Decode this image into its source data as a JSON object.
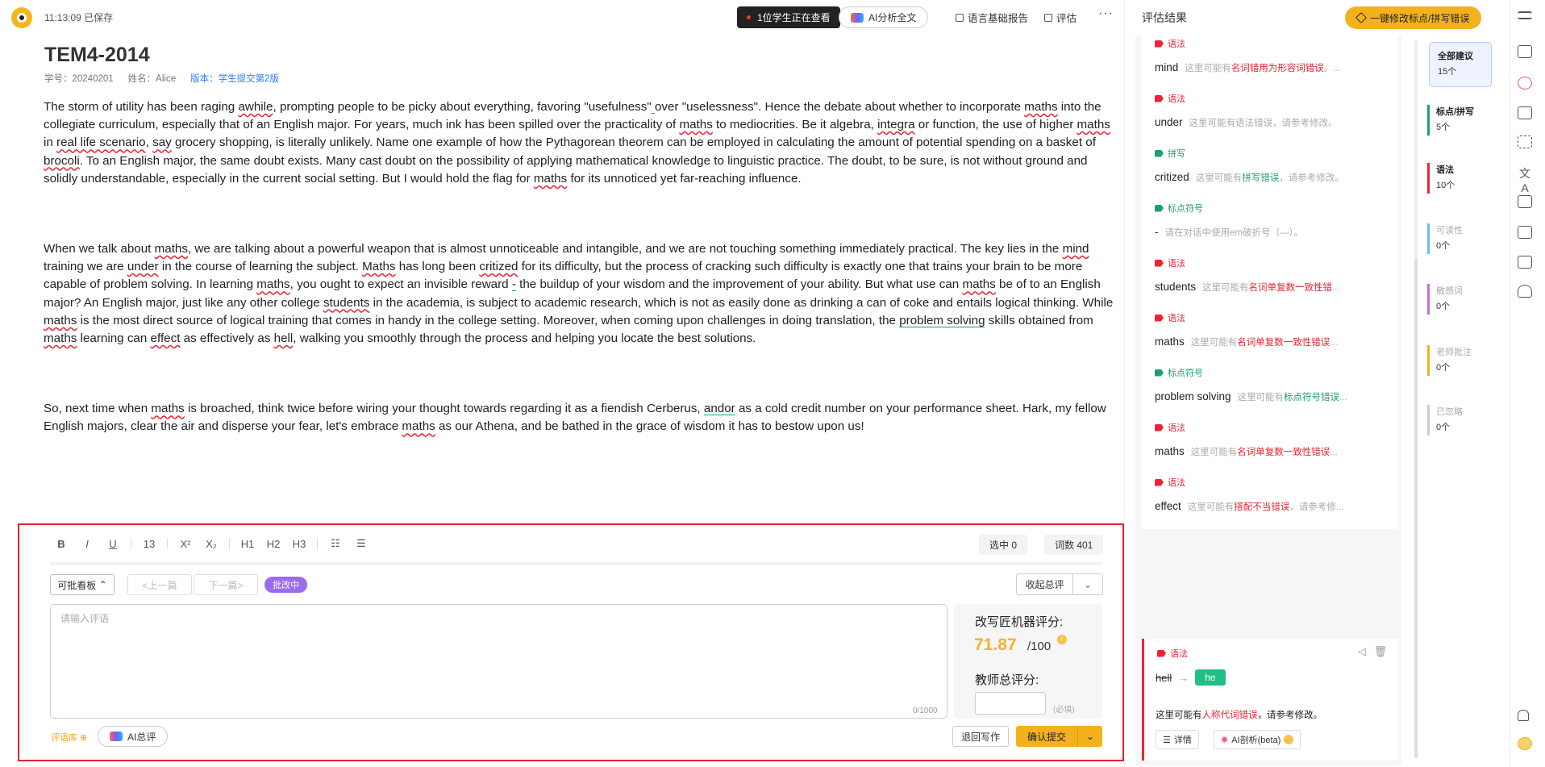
{
  "topbar": {
    "save_time": "11:13:09 已保存",
    "viewers": "1位学生正在查看",
    "ai_analyze": "AI分析全文",
    "lang_report": "语言基础报告",
    "evaluate": "评估",
    "more": "···"
  },
  "doc": {
    "title": "TEM4-2014",
    "student_id": "学号：20240201",
    "name": "姓名：Alice",
    "version": "版本：学生提交第2版",
    "p1": [
      {
        "t": "The storm of utility has been raging "
      },
      {
        "t": "awhile",
        "c": "e-red"
      },
      {
        "t": ", prompting people to be picky about everything, favoring \"usefulness\""
      },
      {
        "t": " ",
        "c": "e-grn"
      },
      {
        "t": "over \"uselessness\". Hence the debate about whether to incorporate "
      },
      {
        "t": "maths",
        "c": "e-red"
      },
      {
        "t": " into the collegiate curriculum, especially that of an English major. For years, much ink has been spilled over the practicality of "
      },
      {
        "t": "maths",
        "c": "e-red"
      },
      {
        "t": " to mediocrities. Be it algebra, "
      },
      {
        "t": "integra",
        "c": "e-red"
      },
      {
        "t": " or function, the use of higher "
      },
      {
        "t": "maths",
        "c": "e-red"
      },
      {
        "t": " in "
      },
      {
        "t": "real life scenario",
        "c": "e-red"
      },
      {
        "t": ", "
      },
      {
        "t": "say",
        "c": "e-red"
      },
      {
        "t": " grocery shopping, is literally unlikely. Name one example of how the Pythagorean theorem can be employed in calculating the amount of potential spending on a basket of "
      },
      {
        "t": "brocoli",
        "c": "e-red"
      },
      {
        "t": ". To an English major, the same doubt exists. Many cast doubt on the possibility of applying mathematical knowledge to linguistic practice. The doubt, to be sure, is not without ground and solidly understandable, especially in the current social setting. But I would hold the flag for "
      },
      {
        "t": "maths",
        "c": "e-red"
      },
      {
        "t": " for its unnoticed yet far-reaching influence."
      }
    ],
    "p2": [
      {
        "t": "When we talk about "
      },
      {
        "t": "maths",
        "c": "e-red"
      },
      {
        "t": ", we are talking about a powerful weapon that is almost unnoticeable and intangible, and we are not touching something immediately practical. The key lies in the "
      },
      {
        "t": "mind",
        "c": "e-red"
      },
      {
        "t": " training we are "
      },
      {
        "t": "under",
        "c": "e-red"
      },
      {
        "t": " in the course of learning the subject. "
      },
      {
        "t": "Maths",
        "c": "e-red"
      },
      {
        "t": " has long been "
      },
      {
        "t": "critized",
        "c": "e-red"
      },
      {
        "t": " for its difficulty, but the process of cracking such difficulty is exactly one that trains your brain to be more capable of problem solving. In learning "
      },
      {
        "t": "maths",
        "c": "e-red"
      },
      {
        "t": ", you ought to expect an invisible reward "
      },
      {
        "t": "-",
        "c": "e-grn"
      },
      {
        "t": " the buildup of your wisdom and the improvement of your ability. But what use can "
      },
      {
        "t": "maths",
        "c": "e-red"
      },
      {
        "t": " be of to an English major? An English major, just like any other college "
      },
      {
        "t": "students",
        "c": "e-red"
      },
      {
        "t": " in the academia, is subject to academic research, which is not as easily done as drinking a can of coke and entails logical thinking. While "
      },
      {
        "t": "maths",
        "c": "e-red"
      },
      {
        "t": " is the most direct source of logical training that comes in handy in the college setting. Moreover, when coming upon challenges in doing translation, the "
      },
      {
        "t": "problem solving",
        "c": "e-grn"
      },
      {
        "t": " skills obtained from "
      },
      {
        "t": "maths",
        "c": "e-red"
      },
      {
        "t": " learning can "
      },
      {
        "t": "effect",
        "c": "e-red"
      },
      {
        "t": " as effectively as "
      },
      {
        "t": "hell",
        "c": "e-red"
      },
      {
        "t": ", walking you smoothly through the process and helping you locate the best solutions."
      }
    ],
    "p3": [
      {
        "t": "So, next time when "
      },
      {
        "t": "maths",
        "c": "e-red"
      },
      {
        "t": " is broached, think twice before wiring your thought towards regarding it as a fiendish Cerberus, "
      },
      {
        "t": "andor",
        "c": "e-grn"
      },
      {
        "t": " as a cold credit number on your performance sheet. Hark, my fellow English majors, clear the air and disperse your fear, let's embrace "
      },
      {
        "t": "maths",
        "c": "e-red"
      },
      {
        "t": " as our Athena, and be bathed in the grace of wisdom it has to bestow upon us!"
      }
    ]
  },
  "editor": {
    "toolbar": [
      "B",
      "I",
      "U",
      "13",
      "X²",
      "X₂",
      "H1",
      "H2",
      "H3"
    ],
    "selected": "选中 0",
    "wordcount": "词数 401",
    "board": "可批看板",
    "prev": "<上一篇",
    "next": "下一篇>",
    "status": "批改中",
    "fold": "收起总评",
    "comment_placeholder": "请输入评语",
    "comment_count": "0/1000",
    "machine_label": "改写匠机器评分:",
    "machine_score": "71.87",
    "machine_max": "/100",
    "teacher_label": "教师总评分:",
    "required": "(必填)",
    "library": "评语库",
    "ai_summary": "AI总评",
    "back": "退回写作",
    "submit": "确认提交"
  },
  "right": {
    "title": "评估结果",
    "fix_all": "一键修改标点/拼写错误",
    "cards": [
      {
        "tag": "语法",
        "color": "#e23",
        "word": "mind",
        "pre": "这里可能有",
        "err": "名词错用为形容词错误",
        "post": "。..."
      },
      {
        "tag": "语法",
        "color": "#e23",
        "word": "under",
        "pre": "这里可能有语法错误，请参考修改。",
        "err": "",
        "post": ""
      },
      {
        "tag": "拼写",
        "color": "#1aa06d",
        "word": "critized",
        "pre": "这里可能有",
        "err": "拼写错误",
        "post": "，请参考修改。",
        "g": true
      },
      {
        "tag": "标点符号",
        "color": "#1aa06d",
        "word": "-",
        "pre": "请在对话中使用em破折号（—）。",
        "err": "",
        "post": ""
      },
      {
        "tag": "语法",
        "color": "#e23",
        "word": "students",
        "pre": "这里可能有",
        "err": "名词单复数一致性错",
        "post": "..."
      },
      {
        "tag": "语法",
        "color": "#e23",
        "word": "maths",
        "pre": "这里可能有",
        "err": "名词单复数一致性错误",
        "post": "..."
      },
      {
        "tag": "标点符号",
        "color": "#1aa06d",
        "word": "problem solving",
        "pre": "这里可能有",
        "err": "标点符号错误",
        "post": "...",
        "g": true
      },
      {
        "tag": "语法",
        "color": "#e23",
        "word": "maths",
        "pre": "这里可能有",
        "err": "名词单复数一致性错误",
        "post": "..."
      },
      {
        "tag": "语法",
        "color": "#e23",
        "word": "effect",
        "pre": "这里可能有",
        "err": "搭配不当错误",
        "post": "，请参考修..."
      }
    ],
    "active": {
      "tag": "语法",
      "word": "hell",
      "fix": "he",
      "desc_pre": "这里可能有",
      "desc_err": "人称代词错误",
      "desc_post": "，请参考修改。",
      "detail": "详情",
      "ai": "AI剖析(beta)"
    },
    "categories": [
      {
        "name": "全部建议",
        "count": "15个",
        "color": "#333"
      },
      {
        "name": "标点/拼写",
        "count": "5个",
        "color": "#1aa06d"
      },
      {
        "name": "语法",
        "count": "10个",
        "color": "#e23"
      },
      {
        "name": "可读性",
        "count": "0个",
        "color": "#6bb7ff"
      },
      {
        "name": "敏感词",
        "count": "0个",
        "color": "#c86bdc"
      },
      {
        "name": "老师批注",
        "count": "0个",
        "color": "#f3b21d"
      },
      {
        "name": "已忽略",
        "count": "0个",
        "color": "#ccc"
      }
    ]
  }
}
